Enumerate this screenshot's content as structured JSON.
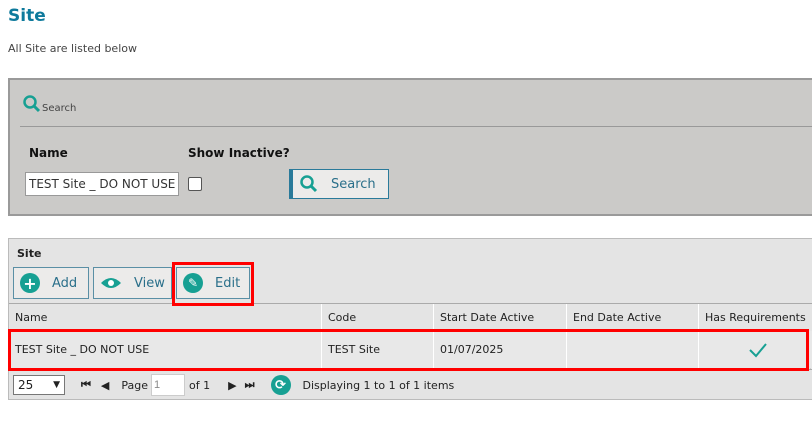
{
  "page": {
    "title": "Site",
    "subtitle": "All Site are listed below"
  },
  "search": {
    "header": "Search",
    "name_label": "Name",
    "name_value": "TEST Site _ DO NOT USE",
    "inactive_label": "Show Inactive?",
    "inactive_checked": false,
    "button": "Search"
  },
  "grid": {
    "title": "Site",
    "add": "Add",
    "view": "View",
    "edit": "Edit",
    "columns": [
      "Name",
      "Code",
      "Start Date Active",
      "End Date Active",
      "Has Requirements"
    ],
    "rows": [
      {
        "name": "TEST Site _ DO NOT USE",
        "code": "TEST Site",
        "start": "01/07/2025",
        "end": "",
        "has_requirements": true
      }
    ]
  },
  "pager": {
    "page_size": "25",
    "page_label": "Page",
    "page": "1",
    "of": "of 1",
    "status": "Displaying 1 to 1 of 1 items"
  },
  "colors": {
    "accent": "#17a093",
    "title": "#0e7a9c",
    "highlight": "#ff0000"
  }
}
